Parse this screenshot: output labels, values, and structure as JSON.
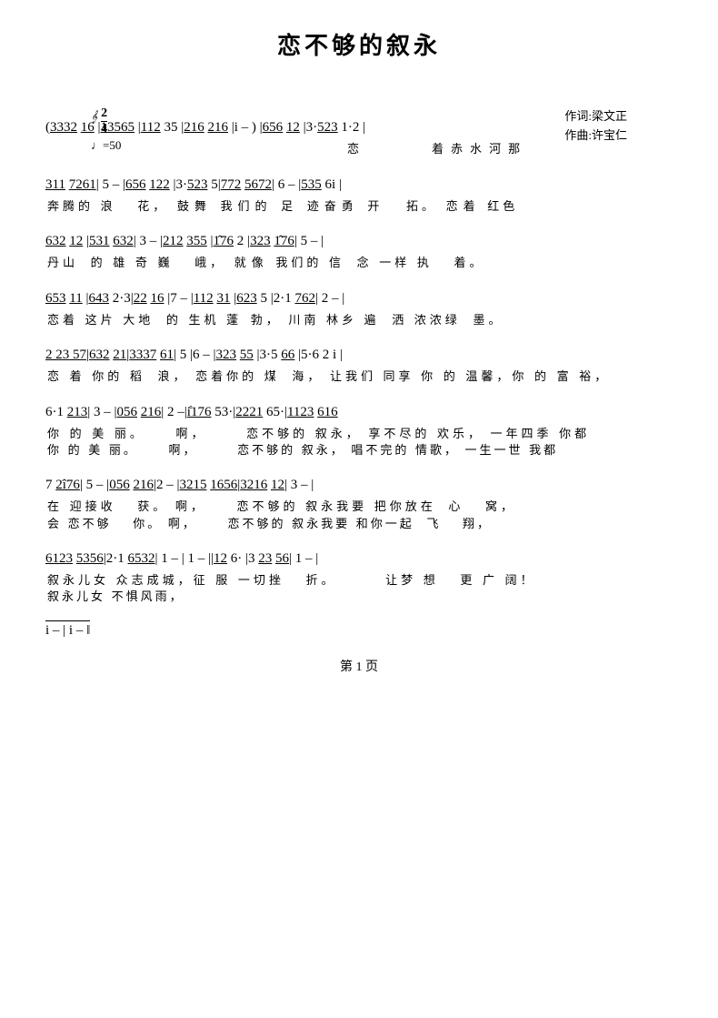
{
  "title": "恋不够的叙永",
  "author": "作词:梁文正",
  "composer": "作曲:许宝仁",
  "time_sig": "2/4",
  "tempo": "♩=50",
  "page": "第 1 页",
  "rows": [
    {
      "notes": "(3332  16 |13565 |112  35  |216  216 |i  –  ) |656  12 |3·523  1·2  |",
      "lyrics": "                                              恋    着   赤   水   河  那"
    },
    {
      "notes": "311  7261|  5  –  |656  122 |3·523  5|772  5672|  6  –  |535  61 |",
      "lyrics": "奔腾的  浪      花，    鼓舞    我们的  足        迹奋勇    开      拓。    恋着    红色"
    },
    {
      "notes": "632  12 |531  632|  3  –  |212  355 |176  2  |323  176|  5  –    |",
      "lyrics": "丹山        的   雄  奇  巍      峨，    就像    我们的  信      念    一样    执        着。"
    },
    {
      "notes": "653  11 |643  2·3|22  16 |7  –  |112  31 |623  5  |2·1  762|  2  –  |",
      "lyrics": "恋着   这片  大地      的  生机    蓬    勃，   川南    林乡   遍        洒    浓浓绿      墨。"
    },
    {
      "notes": "2  23  57|632  21|3337  61|  5  |6  –  |323  55 |3·5  66 |5·6  2  1  |",
      "lyrics": "恋   着    你的    稻      浪，  恋着你的  煤        海，    让我们  同享   你  的    温馨，你  的    富  裕，"
    },
    {
      "notes": "6·1  213|  3  –  |056  216|  2  –|1176  53·|2221  65·|1123  616",
      "lyrics": "你   的   美  丽。         啊，              恋不够的  叙永，  享不尽的  欢乐，  一年四季  你都",
      "lyrics2": "你   的   美  丽。         啊，              恋不够的  叙永，  唱不完的  情歌，  一生一世  我都"
    },
    {
      "notes": "7  2176|  5  –  |056  216|2  –  |3215  1656|3216  12|  3  –  |",
      "lyrics": "在  迎接收       获。   啊，              恋不够的  叙永我要  把你放在    心        窝，",
      "lyrics2": "会  恋不够       你。   啊，              恋不够的  叙永我要  和你一起    飞        翔，"
    },
    {
      "notes": "6123  5356|2·1  6532|  1  –  |  1  –  ||12  6·  |3  23  56|  1  –  |",
      "lyrics": "叙永儿女    众志成城，征  服  一切挫        折。                    让梦    想        更    广    阔！",
      "lyrics2": "叙永儿女    不惧风雨，"
    },
    {
      "notes": "i  –  |  i  –  |‖",
      "lyrics": ""
    }
  ]
}
